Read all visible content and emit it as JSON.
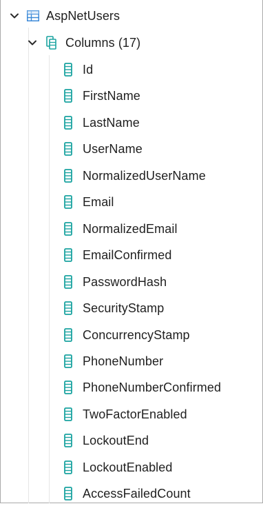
{
  "table": {
    "name": "AspNetUsers",
    "expanded": true,
    "icon": "table-icon"
  },
  "columns_folder": {
    "label": "Columns (17)",
    "expanded": true,
    "icon": "columns-folder-icon"
  },
  "colors": {
    "accent_teal": "#1aa3a0",
    "table_blue": "#3c8ad8",
    "chevron": "#2b2b2b"
  },
  "columns": [
    {
      "name": "Id"
    },
    {
      "name": "FirstName"
    },
    {
      "name": "LastName"
    },
    {
      "name": "UserName"
    },
    {
      "name": "NormalizedUserName"
    },
    {
      "name": "Email"
    },
    {
      "name": "NormalizedEmail"
    },
    {
      "name": "EmailConfirmed"
    },
    {
      "name": "PasswordHash"
    },
    {
      "name": "SecurityStamp"
    },
    {
      "name": "ConcurrencyStamp"
    },
    {
      "name": "PhoneNumber"
    },
    {
      "name": "PhoneNumberConfirmed"
    },
    {
      "name": "TwoFactorEnabled"
    },
    {
      "name": "LockoutEnd"
    },
    {
      "name": "LockoutEnabled"
    },
    {
      "name": "AccessFailedCount"
    }
  ]
}
